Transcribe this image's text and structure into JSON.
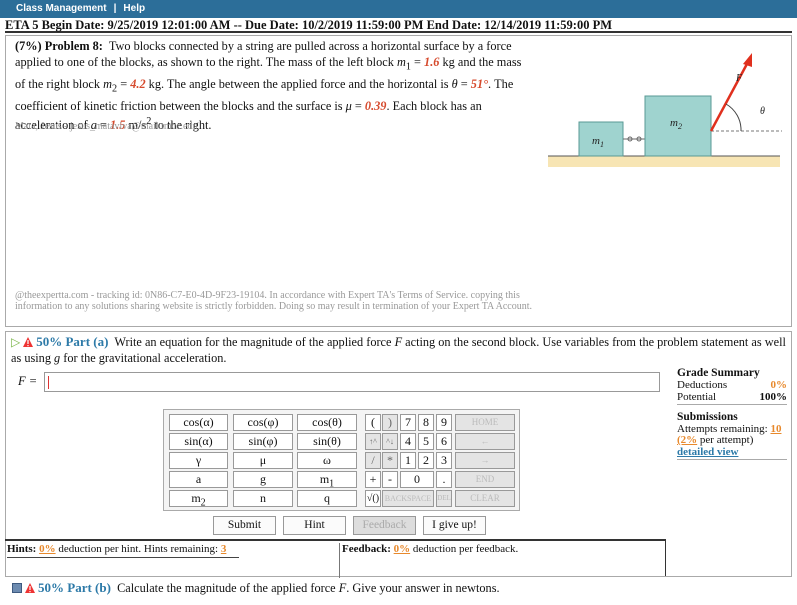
{
  "topbar": {
    "item1": "Class Management",
    "separator": "|",
    "item2": "Help"
  },
  "dates": {
    "text": "ETA 5 Begin Date: 9/25/2019 12:01:00 AM -- Due Date: 10/2/2019 11:59:00 PM End Date: 12/14/2019 11:59:00 PM"
  },
  "problem": {
    "header": "(7%) Problem 8:",
    "s1": "Two blocks connected by a string are pulled across a horizontal surface by a force applied to one of the blocks, as shown to the right. The mass of the left block ",
    "m1_sym": "m",
    "m1_sub": "1",
    "s2": " = ",
    "m1_val": "1.6",
    "s3": " kg and the mass of the right block ",
    "m2_sym": "m",
    "m2_sub": "2",
    "s4": " = ",
    "m2_val": "4.2",
    "s5": " kg. The angle between the applied force and the horizontal is ",
    "theta_sym": "θ",
    "s6": " = ",
    "theta_val": "51°",
    "s7": ". The coefficient of kinetic friction between the blocks and the surface is ",
    "mu_sym": "μ",
    "s8": " = ",
    "mu_val": "0.39",
    "s9": ". Each block has an acceleration of ",
    "a_sym": "a",
    "s10": " = ",
    "a_val": "1.5",
    "s11": " m/s",
    "a_exp": "2",
    "s12": " to the right.",
    "author": "Mata, Jesus - jesus_mataviva@mail.tmcc.edu",
    "copyright": "@theexpertta.com - tracking id: 0N86-C7-E0-4D-9F23-19104. In accordance with Expert TA's Terms of Service. copying this information to any solutions sharing website is strictly forbidden. Doing so may result in termination of your Expert TA Account."
  },
  "figure": {
    "label_m1": "m",
    "label_m1_sub": "1",
    "label_m2": "m",
    "label_m2_sub": "2",
    "label_F": "F",
    "label_theta": "θ",
    "colors": {
      "block": "#9fd3cf",
      "block_border": "#5a9a94",
      "ground": "#f7e5b4",
      "force": "#e0301e"
    }
  },
  "part_a": {
    "title": "50% Part (a)",
    "p1": "Write an equation for the magnitude of the applied force ",
    "F_sym": "F",
    "p2": " acting on the second block. Use variables from the problem statement as well as using ",
    "g_sym": "g",
    "p3": " for the gravitational acceleration.",
    "answer_label": "F =",
    "answer_value": ""
  },
  "grade_summary": {
    "title": "Grade Summary",
    "deductions_label": "Deductions",
    "deductions_value": "0%",
    "potential_label": "Potential",
    "potential_value": "100%"
  },
  "submissions": {
    "title": "Submissions",
    "attempts_label": "Attempts remaining:",
    "attempts_value": "10",
    "per_attempt_value": "(2%",
    "per_attempt_label": "per attempt)",
    "detailed_view": "detailed view"
  },
  "keypad": {
    "k_cos_a": "cos(α)",
    "k_cos_phi": "cos(φ)",
    "k_cos_theta": "cos(θ)",
    "k_sin_a": "sin(α)",
    "k_sin_phi": "sin(φ)",
    "k_sin_theta": "sin(θ)",
    "k_gamma": "γ",
    "k_mu": "μ",
    "k_omega": "ω",
    "k_a": "a",
    "k_g": "g",
    "k_m1": "m",
    "k_m1_sub": "1",
    "k_m2": "m",
    "k_m2_sub": "2",
    "k_n": "n",
    "k_q": "q",
    "k_lparen": "(",
    "k_rparen": ")",
    "k_7": "7",
    "k_8": "8",
    "k_9": "9",
    "k_home": "HOME",
    "k_up": "↑^",
    "k_down": "^↓",
    "k_4": "4",
    "k_5": "5",
    "k_6": "6",
    "k_left": "←",
    "k_div": "/",
    "k_mul": "*",
    "k_1": "1",
    "k_2": "2",
    "k_3": "3",
    "k_right": "→",
    "k_plus": "+",
    "k_minus": "-",
    "k_0": "0",
    "k_dot": ".",
    "k_end": "END",
    "k_sqrt": "√()",
    "k_backspace": "BACKSPACE",
    "k_del": "DEL",
    "k_clear": "CLEAR"
  },
  "buttons": {
    "submit": "Submit",
    "hint": "Hint",
    "feedback": "Feedback",
    "give_up": "I give up!"
  },
  "hints": {
    "label": "Hints:",
    "hint_pct": "0%",
    "text": "deduction per hint. Hints remaining:",
    "remaining": "3",
    "fb_label": "Feedback:",
    "fb_pct": "0%",
    "fb_text": "deduction per feedback."
  },
  "part_b": {
    "title": "50% Part (b)",
    "p1": "Calculate the magnitude of the applied force ",
    "F_sym": "F",
    "p2": ". Give your answer in newtons."
  }
}
